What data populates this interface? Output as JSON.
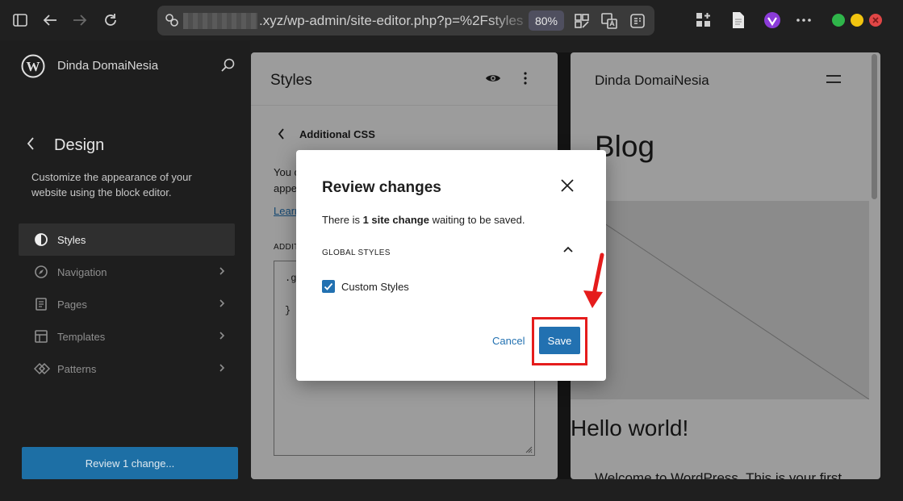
{
  "browser": {
    "url_visible": ".xyz/wp-admin/site-editor.php?p=%2Fstyles",
    "zoom": "80%"
  },
  "sidebar": {
    "site_name": "Dinda DomaiNesia",
    "section_title": "Design",
    "description": "Customize the appearance of your website using the block editor.",
    "items": [
      {
        "label": "Styles",
        "icon": "half-circle-icon",
        "active": true
      },
      {
        "label": "Navigation",
        "icon": "compass-icon",
        "active": false
      },
      {
        "label": "Pages",
        "icon": "page-icon",
        "active": false
      },
      {
        "label": "Templates",
        "icon": "layout-icon",
        "active": false
      },
      {
        "label": "Patterns",
        "icon": "diamond-icon",
        "active": false
      }
    ],
    "review_button": "Review 1 change..."
  },
  "styles_panel": {
    "title": "Styles",
    "subtitle": "Additional CSS",
    "desc_line1": "You c",
    "desc_line2": "appe",
    "link": "Learn",
    "field_label": "ADDITI",
    "code_line1": ".g",
    "code_line2": "}"
  },
  "preview": {
    "site_name": "Dinda DomaiNesia",
    "blog_title": "Blog",
    "post_title": "Hello world!",
    "body_text": "Welcome to WordPress. This is your first"
  },
  "modal": {
    "title": "Review changes",
    "msg_prefix": "There is ",
    "msg_bold": "1 site change",
    "msg_suffix": " waiting to be saved.",
    "group_label": "GLOBAL STYLES",
    "checkbox_label": "Custom Styles",
    "checkbox_checked": true,
    "cancel": "Cancel",
    "save": "Save"
  },
  "colors": {
    "accent": "#2271b1",
    "highlight": "#e51c1c"
  }
}
